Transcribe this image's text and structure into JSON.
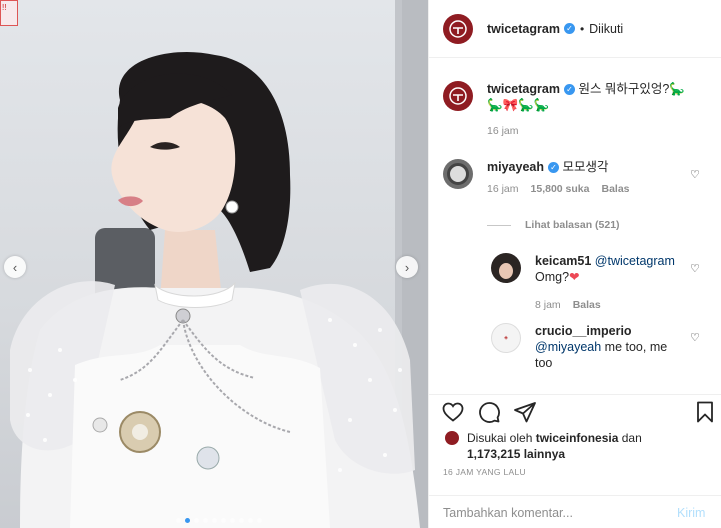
{
  "photo": {
    "sign_text": "!!",
    "dots_count": 10,
    "active_dot": 1
  },
  "header": {
    "username": "twicetagram",
    "verified": true,
    "separator": "•",
    "follow_status": "Diikuti"
  },
  "caption": {
    "username": "twicetagram",
    "text": "원스 뭐하구있엉?🦕",
    "text_line2": "🦕🎀🦕🦕",
    "time": "16 jam"
  },
  "comments": [
    {
      "username": "miyayeah",
      "verified": true,
      "text": "모모생각",
      "time": "16 jam",
      "likes": "15,800 suka",
      "reply_label": "Balas",
      "view_replies": "Lihat balasan (521)"
    }
  ],
  "replies": [
    {
      "username": "keicam51",
      "mention": "@twicetagram",
      "text": "Omg?",
      "emoji": "❤",
      "time": "8 jam",
      "reply_label": "Balas"
    },
    {
      "username": "crucio__imperio",
      "mention": "@miyayeah",
      "text": "me too, me too"
    }
  ],
  "likes": {
    "prefix": "Disukai oleh",
    "user": "twiceinfonesia",
    "joiner": "dan",
    "count": "1,173,215 lainnya"
  },
  "timestamp": "16 JAM YANG LALU",
  "composer": {
    "placeholder": "Tambahkan komentar...",
    "post_label": "Kirim"
  },
  "colors": {
    "accent": "#3897f0",
    "brand": "#8f1c22",
    "heart": "#ed4956",
    "muted": "#8e8e8e"
  }
}
